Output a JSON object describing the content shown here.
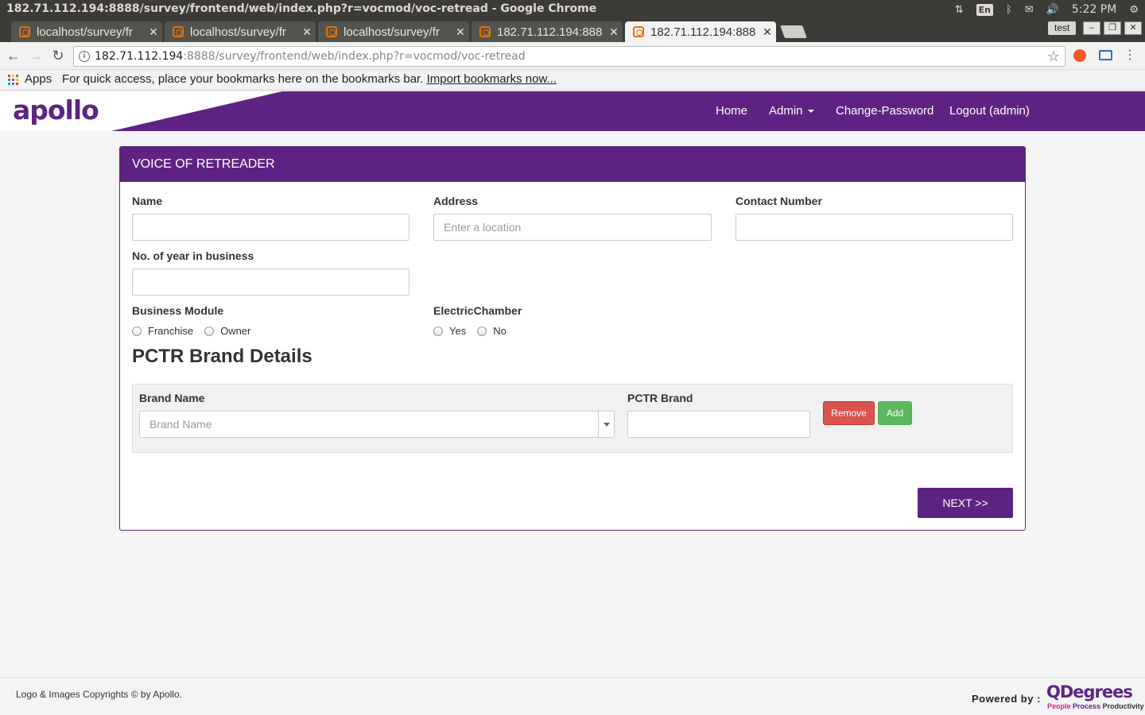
{
  "os": {
    "window_title": "182.71.112.194:8888/survey/frontend/web/index.php?r=vocmod/voc-retread - Google Chrome",
    "keyboard": "En",
    "clock": "5:22 PM"
  },
  "browser": {
    "tabs": [
      {
        "label": "localhost/survey/fr",
        "active": false
      },
      {
        "label": "localhost/survey/fr",
        "active": false
      },
      {
        "label": "localhost/survey/fr",
        "active": false
      },
      {
        "label": "182.71.112.194:888",
        "active": false
      },
      {
        "label": "182.71.112.194:888",
        "active": true
      }
    ],
    "profile": "test",
    "url_host": "182.71.112.194",
    "url_rest": ":8888/survey/frontend/web/index.php?r=vocmod/voc-retread",
    "bookmarks": {
      "apps_label": "Apps",
      "hint": "For quick access, place your bookmarks here on the bookmarks bar.",
      "import_link": "Import bookmarks now..."
    }
  },
  "site": {
    "logo": "apollo",
    "brand_color": "#5e2382",
    "nav": {
      "home": "Home",
      "admin": "Admin",
      "change_password": "Change-Password",
      "logout": "Logout (admin)"
    }
  },
  "form": {
    "panel_title": "VOICE OF RETREADER",
    "name_label": "Name",
    "name_value": "",
    "address_label": "Address",
    "address_placeholder": "Enter a location",
    "contact_label": "Contact Number",
    "contact_value": "",
    "years_label": "No. of year in business",
    "years_value": "",
    "business_module_label": "Business Module",
    "business_module_options": [
      "Franchise",
      "Owner"
    ],
    "electric_chamber_label": "ElectricChamber",
    "electric_chamber_options": [
      "Yes",
      "No"
    ],
    "section_title": "PCTR Brand Details",
    "brand_name_label": "Brand Name",
    "brand_name_placeholder": "Brand Name",
    "pctr_brand_label": "PCTR Brand",
    "pctr_brand_value": "",
    "remove_label": "Remove",
    "add_label": "Add",
    "next_label": "NEXT >>"
  },
  "footer": {
    "copyright": "Logo & Images Copyrights © by Apollo.",
    "powered_by": "Powered by :",
    "company": "QDegrees",
    "tagline_1": "People",
    "tagline_2": "Process",
    "tagline_3": "Productivity"
  }
}
